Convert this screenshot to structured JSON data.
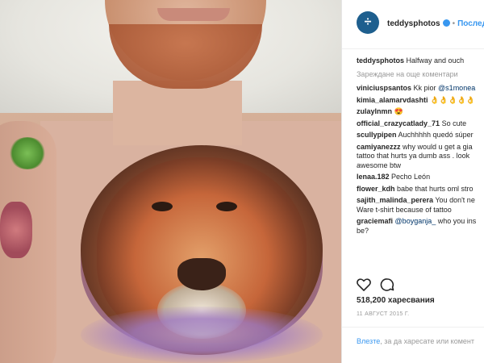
{
  "post": {
    "username": "teddysphotos",
    "separator": "•",
    "follow_label": "Последв",
    "caption_user": "teddysphotos",
    "caption_text": "Halfway and ouch",
    "load_more": "Зареждане на още коментари",
    "likes": "518,200 харесвания",
    "date": "11 АВГУСТ 2015 Г.",
    "login_link": "Влезте",
    "login_text": ", за да харесате или комент"
  },
  "comments": [
    {
      "user": "viniciuspsantos",
      "text": " Kk pior ",
      "mention": "@s1monea"
    },
    {
      "user": "kimia_alamarvdashti",
      "text": " 👌👌👌👌👌"
    },
    {
      "user": "zulaylnmn",
      "text": " 😍"
    },
    {
      "user": "official_crazycatlady_71",
      "text": " So cute"
    },
    {
      "user": "scullypipen",
      "text": " Auchhhhh quedó súper"
    },
    {
      "user": "camiyanezzz",
      "text": " why would u get a gia"
    },
    {
      "user": "",
      "text": "tattoo that hurts ya dumb ass . look"
    },
    {
      "user": "",
      "text": "awesome btw"
    },
    {
      "user": "lenaa.182",
      "text": " Pecho León"
    },
    {
      "user": "flower_kdh",
      "text": " babe that hurts oml stro"
    },
    {
      "user": "sajith_malinda_perera",
      "text": " You don't ne"
    },
    {
      "user": "",
      "text": "Ware t-shirt because of tattoo"
    },
    {
      "user": "graciemafi",
      "text": " ",
      "mention": "@boyganja_",
      "tail": " who you ins"
    },
    {
      "user": "",
      "text": "be?"
    }
  ],
  "icons": {
    "avatar_glyph": "÷",
    "like": "heart-icon",
    "comment": "comment-icon"
  },
  "colors": {
    "link": "#3897f0",
    "text": "#262626",
    "muted": "#999999"
  }
}
